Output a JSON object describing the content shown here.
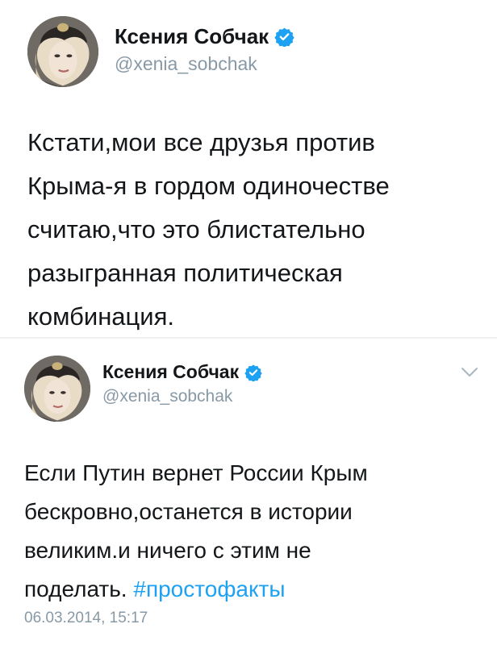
{
  "colors": {
    "text": "#14171a",
    "muted": "#8899a6",
    "accent": "#1da1f2",
    "separator": "#eef0f2"
  },
  "tweets": [
    {
      "author": {
        "display_name": "Ксения Собчак",
        "handle": "@xenia_sobchak",
        "verified_icon": "verified-badge-icon",
        "avatar": "avatar-photo"
      },
      "text": "Кстати,мои все друзья против\nКрыма-я в гордом одиночестве\nсчитаю,что это блистательно\nразыгранная политическая\nкомбинация."
    },
    {
      "author": {
        "display_name": "Ксения Собчак",
        "handle": "@xenia_sobchak",
        "verified_icon": "verified-badge-icon",
        "avatar": "avatar-photo"
      },
      "menu_icon": "chevron-down-icon",
      "text": "Если Путин вернет России Крым\nбескровно,останется в истории\nвеликим.и ничего с этим не\nподелать. ",
      "hashtag": "#простофакты",
      "timestamp": "06.03.2014, 15:17"
    }
  ]
}
